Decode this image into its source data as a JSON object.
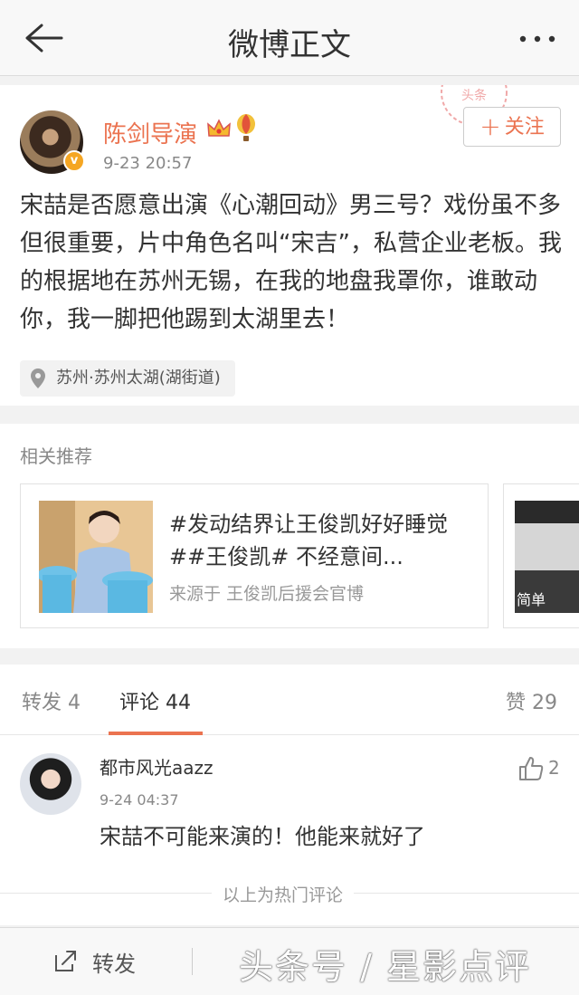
{
  "nav": {
    "title": "微博正文"
  },
  "post": {
    "username": "陈剑导演",
    "badge": "v",
    "time": "9-23 20:57",
    "follow_label": "关注",
    "text": "宋喆是否愿意出演《心潮回动》男三号？戏份虽不多但很重要，片中角色名叫“宋吉”，私营企业老板。我的根据地在苏州无锡，在我的地盘我罩你，谁敢动你，我一脚把他踢到太湖里去！",
    "location": "苏州·苏州太湖(湖街道)",
    "stamp_text": "头条"
  },
  "related": {
    "header": "相关推荐",
    "card1": {
      "title": "#发动结界让王俊凯好好睡觉##王俊凯# 不经意间...",
      "source": "来源于 王俊凯后援会官博"
    },
    "card2": {
      "thumb_text": "简单"
    }
  },
  "tabs": {
    "repost": "转发 4",
    "comments": "评论 44",
    "likes": "赞 29"
  },
  "comment": {
    "user": "都市风光aazz",
    "time": "9-24 04:37",
    "text": "宋喆不可能来演的！他能来就好了",
    "likes": "2",
    "hot_label": "以上为热门评论"
  },
  "bottom": {
    "share_label": "转发",
    "watermark": "头条号 / 星影点评"
  }
}
